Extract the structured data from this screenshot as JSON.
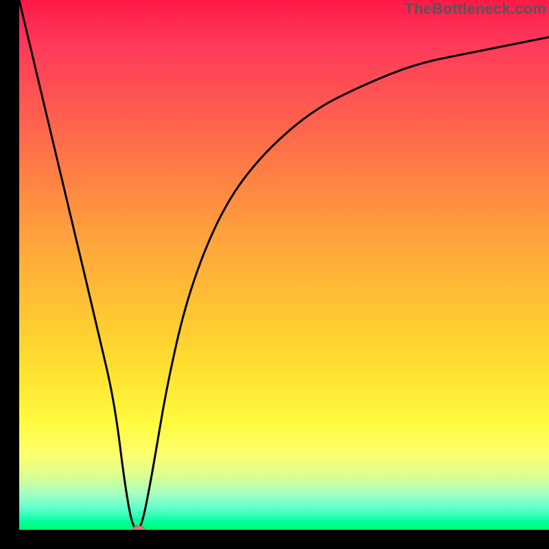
{
  "watermark": "TheBottleneck.com",
  "chart_data": {
    "type": "line",
    "title": "",
    "xlabel": "",
    "ylabel": "",
    "xlim": [
      0,
      100
    ],
    "ylim": [
      0,
      100
    ],
    "grid": false,
    "series": [
      {
        "name": "curve",
        "x": [
          0,
          5,
          10,
          15,
          18,
          20,
          21.5,
          23,
          25,
          28,
          32,
          38,
          45,
          55,
          65,
          75,
          85,
          100
        ],
        "y": [
          100,
          79,
          58,
          37,
          24,
          8,
          0,
          0,
          10,
          28,
          45,
          60,
          70,
          79,
          84,
          88,
          90,
          93
        ]
      }
    ],
    "marker": {
      "x": 22.5,
      "y": 0
    },
    "gradient_colors": {
      "top": "#ff1948",
      "bottom": "#00ff68"
    }
  }
}
